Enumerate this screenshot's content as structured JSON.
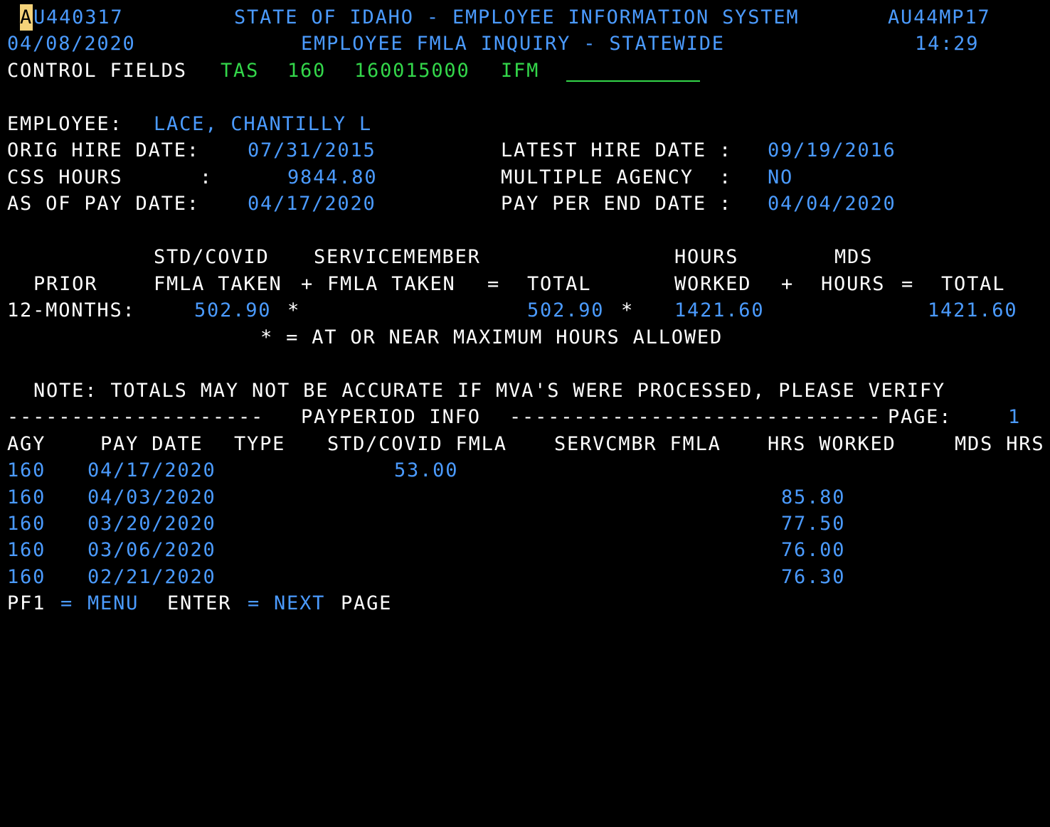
{
  "header": {
    "cursor_char": "A",
    "screen_id_rest": "U440317",
    "title": "STATE OF IDAHO - EMPLOYEE INFORMATION SYSTEM",
    "program_id": "AU44MP17",
    "date": "04/08/2020",
    "subtitle": "EMPLOYEE FMLA INQUIRY - STATEWIDE",
    "time": "14:29"
  },
  "control": {
    "label": "CONTROL FIELDS",
    "field1": "TAS",
    "field2": "160",
    "field3": "160015000",
    "field4": "IFM",
    "input_value": ""
  },
  "employee": {
    "label": "EMPLOYEE:",
    "name": "LACE, CHANTILLY L",
    "orig_hire_label": "ORIG HIRE DATE:",
    "orig_hire_date": "07/31/2015",
    "latest_hire_label": "LATEST HIRE DATE :",
    "latest_hire_date": "09/19/2016",
    "css_hours_label": "CSS HOURS      :",
    "css_hours": "9844.80",
    "multiple_agency_label": "MULTIPLE AGENCY  :",
    "multiple_agency": "NO",
    "as_of_pay_label": "AS OF PAY DATE:",
    "as_of_pay_date": "04/17/2020",
    "pay_per_end_label": "PAY PER END DATE :",
    "pay_per_end_date": "04/04/2020"
  },
  "summary": {
    "h1_std": "STD/COVID",
    "h1_serv": "SERVICEMEMBER",
    "h1_hours": "HOURS",
    "h1_mds": "MDS",
    "h2_prior": "PRIOR",
    "h2_fmla": "FMLA TAKEN",
    "plus1": "+",
    "h2_serv_fmla": "FMLA TAKEN",
    "equals1": "=",
    "h2_total1": "TOTAL",
    "h2_worked": "WORKED",
    "plus2": "+",
    "h2_mds_hours": "HOURS",
    "equals2": "=",
    "h2_total2": "TOTAL",
    "row_label": "12-MONTHS:",
    "std_value": "502.90",
    "std_flag": "*",
    "total_fmla": "502.90",
    "total_flag": "*",
    "hours_worked": "1421.60",
    "total_hours": "1421.60",
    "legend": "* = AT OR NEAR MAXIMUM HOURS ALLOWED"
  },
  "note": "NOTE: TOTALS MAY NOT BE ACCURATE IF MVA'S WERE PROCESSED, PLEASE VERIFY",
  "payperiod": {
    "divider_left": "--------------------",
    "title": "PAYPERIOD INFO",
    "divider_right": "-----------------------------",
    "page_label": "PAGE:",
    "page_number": "1",
    "columns": [
      "AGY",
      "PAY DATE",
      "TYPE",
      "STD/COVID FMLA",
      "SERVCMBR FMLA",
      "HRS WORKED",
      "MDS HRS"
    ],
    "rows": [
      {
        "agy": "160",
        "pay_date": "04/17/2020",
        "type": "",
        "std_fmla": "53.00",
        "servcmbr_fmla": "",
        "hrs_worked": "",
        "mds_hrs": ""
      },
      {
        "agy": "160",
        "pay_date": "04/03/2020",
        "type": "",
        "std_fmla": "",
        "servcmbr_fmla": "",
        "hrs_worked": "85.80",
        "mds_hrs": ""
      },
      {
        "agy": "160",
        "pay_date": "03/20/2020",
        "type": "",
        "std_fmla": "",
        "servcmbr_fmla": "",
        "hrs_worked": "77.50",
        "mds_hrs": ""
      },
      {
        "agy": "160",
        "pay_date": "03/06/2020",
        "type": "",
        "std_fmla": "",
        "servcmbr_fmla": "",
        "hrs_worked": "76.00",
        "mds_hrs": ""
      },
      {
        "agy": "160",
        "pay_date": "02/21/2020",
        "type": "",
        "std_fmla": "",
        "servcmbr_fmla": "",
        "hrs_worked": "76.30",
        "mds_hrs": ""
      }
    ]
  },
  "footer": {
    "pf1_key": "PF1",
    "pf1_eq": "=",
    "pf1_action": "MENU",
    "enter_key": "ENTER",
    "enter_eq": "=",
    "enter_action": "NEXT",
    "enter_suffix": "PAGE"
  },
  "colors": {
    "background": "#000000",
    "label_white": "#ffffff",
    "value_blue": "#4b9bff",
    "control_green": "#33d64a",
    "cursor_yellow": "#f5d37a"
  }
}
